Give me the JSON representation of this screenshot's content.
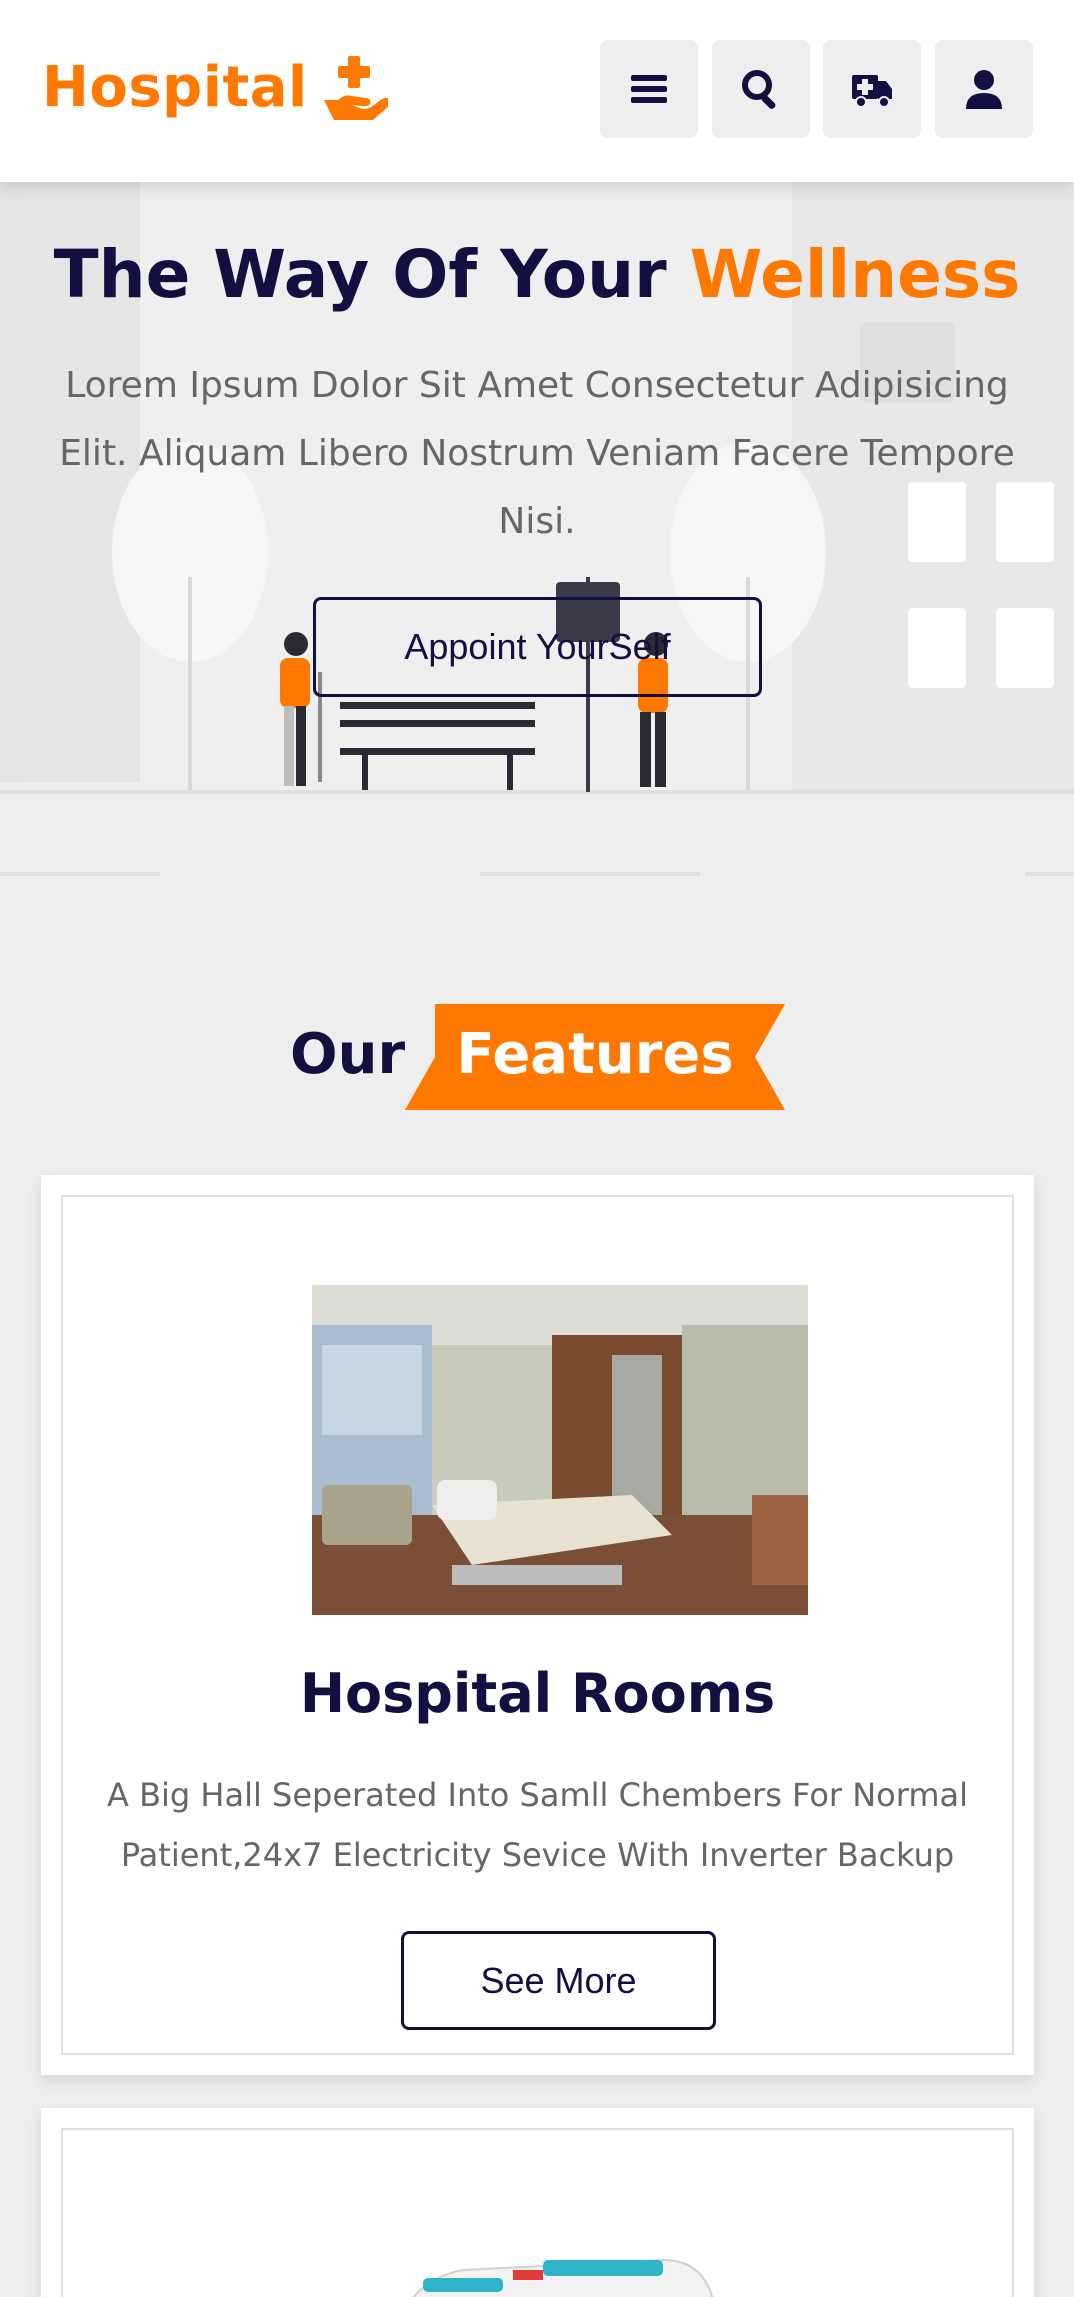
{
  "header": {
    "logo_text": "Hospital",
    "logo_icon": "hand-holding-medical-icon",
    "buttons": [
      {
        "name": "menu-button",
        "icon": "bars-icon"
      },
      {
        "name": "search-button",
        "icon": "search-icon"
      },
      {
        "name": "ambulance-button",
        "icon": "ambulance-icon"
      },
      {
        "name": "account-button",
        "icon": "user-icon"
      }
    ]
  },
  "hero": {
    "title_main": "The Way Of Your ",
    "title_accent": "Wellness",
    "text": "Lorem Ipsum Dolor Sit Amet Consectetur Adipisicing Elit. Aliquam Libero Nostrum Veniam Facere Tempore Nisi.",
    "button_label": "Appoint YourSelf"
  },
  "features": {
    "heading_prefix": "Our",
    "heading_highlight": "Features",
    "cards": [
      {
        "title": "Hospital Rooms",
        "text": "A Big Hall Seperated Into Samll Chembers For Normal Patient,24x7 Electricity Sevice With Inverter Backup",
        "button_label": "See More"
      }
    ]
  },
  "colors": {
    "accent": "#ff7800",
    "dark": "#130f40",
    "text_muted": "#666666",
    "background": "#eeeeee"
  }
}
